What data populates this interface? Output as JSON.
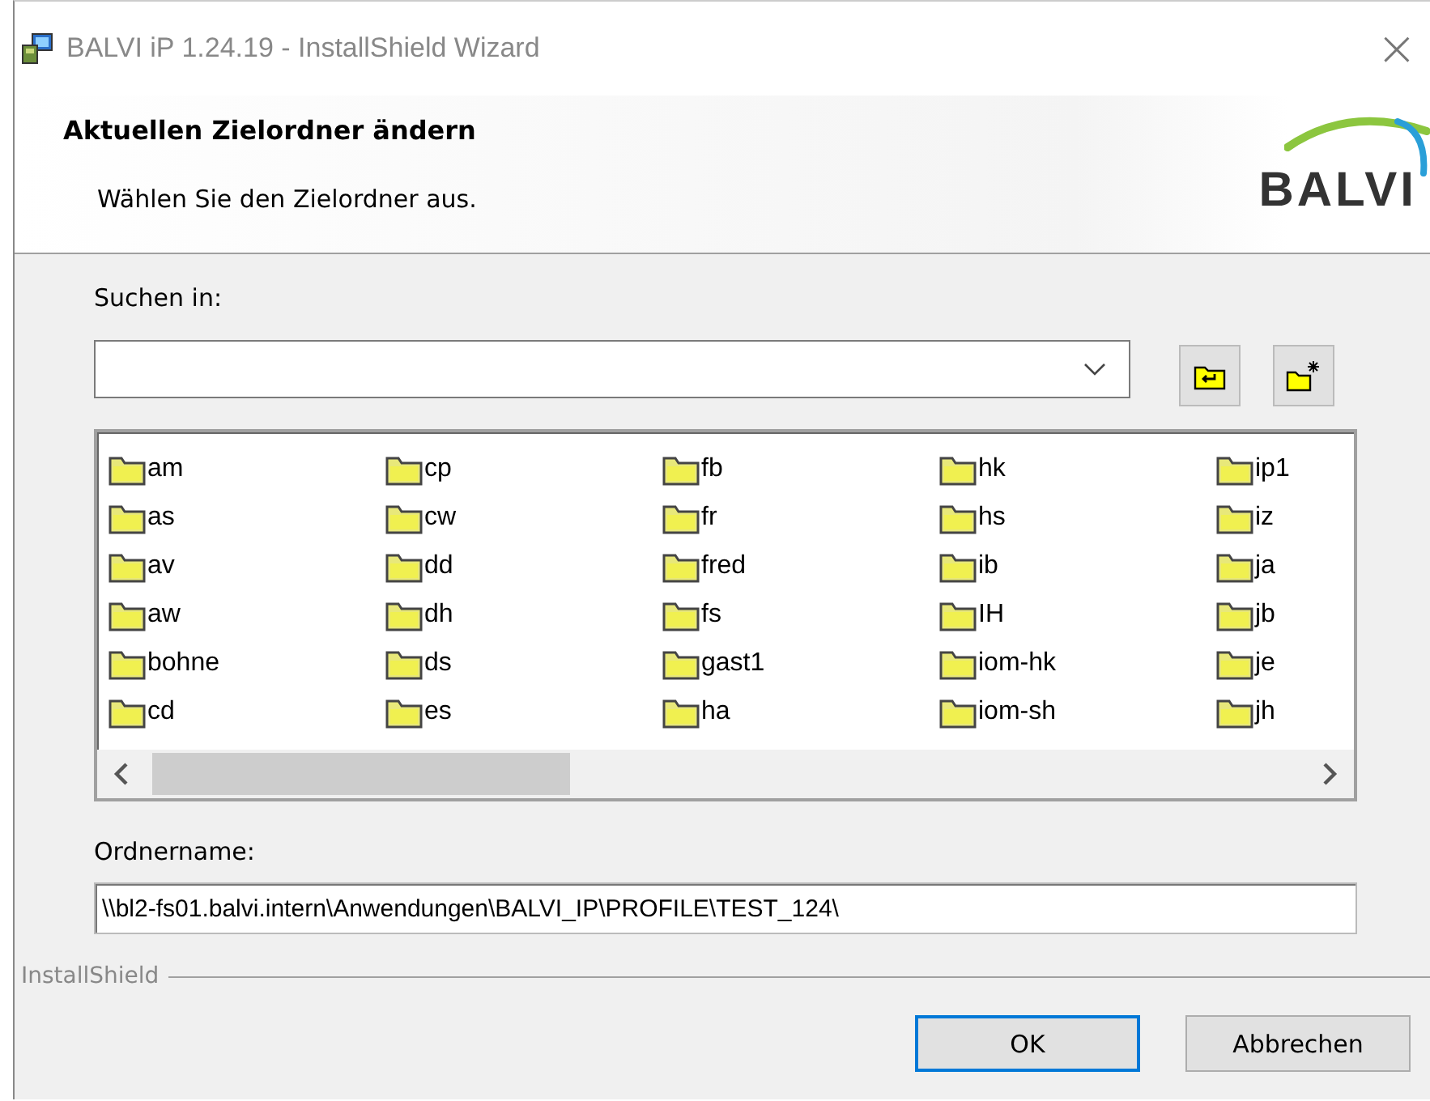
{
  "window": {
    "title": "BALVI iP 1.24.19 - InstallShield Wizard",
    "close": "×"
  },
  "header": {
    "title": "Aktuellen Zielordner ändern",
    "subtitle": "Wählen Sie den Zielordner aus.",
    "logo": "BALVI"
  },
  "look_in": {
    "label": "Suchen in:"
  },
  "folders": [
    "am",
    "as",
    "av",
    "aw",
    "bohne",
    "cd",
    "cp",
    "cw",
    "dd",
    "dh",
    "ds",
    "es",
    "fb",
    "fr",
    "fred",
    "fs",
    "gast1",
    "ha",
    "hk",
    "hs",
    "ib",
    "IH",
    "iom-hk",
    "iom-sh",
    "ip1",
    "iz",
    "ja",
    "jb",
    "je",
    "jh"
  ],
  "folder_name": {
    "label": "Ordnername:",
    "value": "\\\\bl2-fs01.balvi.intern\\Anwendungen\\BALVI_IP\\PROFILE\\TEST_124\\"
  },
  "footer": {
    "brand": "InstallShield"
  },
  "buttons": [
    {
      "label": "OK",
      "default": true
    },
    {
      "label": "Abbrechen",
      "default": false
    }
  ]
}
